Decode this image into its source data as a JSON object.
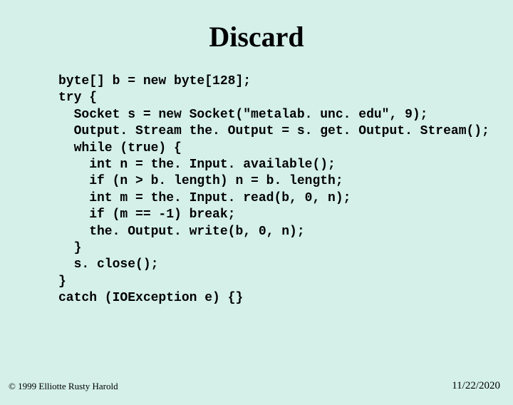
{
  "title": "Discard",
  "code": {
    "l1": "byte[] b = new byte[128];",
    "l2": "try {",
    "l3": "  Socket s = new Socket(\"metalab. unc. edu\", 9);",
    "l4": "  Output. Stream the. Output = s. get. Output. Stream();",
    "l5": "  while (true) {",
    "l6": "    int n = the. Input. available();",
    "l7": "    if (n > b. length) n = b. length;",
    "l8": "    int m = the. Input. read(b, 0, n);",
    "l9": "    if (m == -1) break;",
    "l10": "    the. Output. write(b, 0, n);",
    "l11": "  }",
    "l12": "  s. close();",
    "l13": "}",
    "l14": "catch (IOException e) {}"
  },
  "footer": {
    "copyright": "© 1999 Elliotte Rusty Harold",
    "date": "11/22/2020"
  }
}
